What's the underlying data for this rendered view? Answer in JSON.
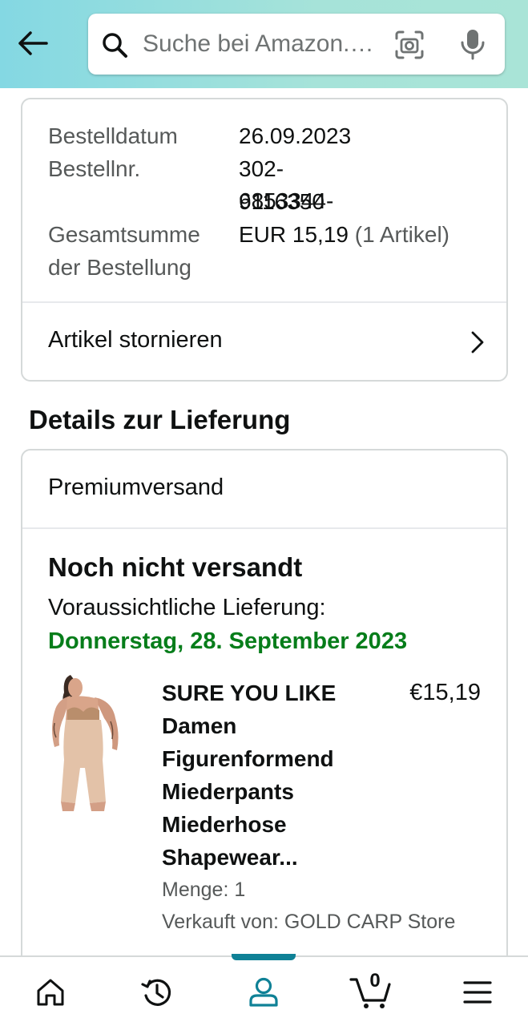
{
  "header": {
    "search_placeholder": "Suche bei Amazon.de",
    "back_icon": "arrow-left-icon",
    "camera_icon": "camera-scan-icon",
    "mic_icon": "microphone-icon"
  },
  "order": {
    "date_label": "Bestelldatum",
    "date_value": "26.09.2023",
    "number_label": "Bestellnr.",
    "number_value_line1": "302-6853344-",
    "number_value_line2": "9116350",
    "total_label_line1": "Gesamtsumme",
    "total_label_line2": "der Bestellung",
    "total_value": "EUR 15,19",
    "total_items": "(1 Artikel)",
    "cancel_label": "Artikel stornieren"
  },
  "delivery": {
    "section_title": "Details zur Lieferung",
    "shipping_method": "Premiumversand",
    "status": "Noch nicht versandt",
    "expected_label": "Voraussichtliche Lieferung:",
    "expected_date": "Donnerstag, 28. September 2023"
  },
  "product": {
    "title_line1": "SURE YOU LIKE",
    "title_line2": "Damen",
    "title_line3": "Figurenformend",
    "title_line4": "Miederpants",
    "title_line5": "Miederhose",
    "title_line6": "Shapewear...",
    "price": "€15,19",
    "quantity": "Menge: 1",
    "seller": "Verkauft von: GOLD CARP Store"
  },
  "bottom_nav": {
    "items": [
      "home-icon",
      "history-icon",
      "account-icon",
      "cart-icon",
      "menu-icon"
    ],
    "active": "account-icon",
    "cart_count": "0"
  },
  "colors": {
    "header_gradient_start": "#84d8e3",
    "header_gradient_end": "#a9e4d7",
    "delivery_green": "#067d1a",
    "active_nav": "#0f8196"
  }
}
